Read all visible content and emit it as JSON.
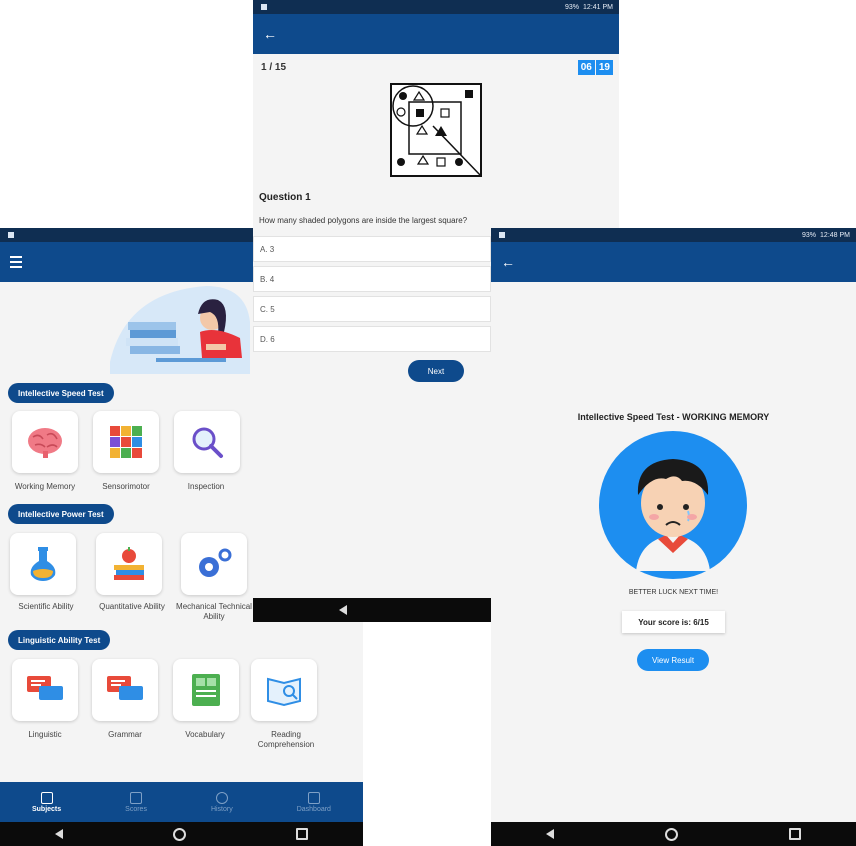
{
  "status_mid": {
    "battery": "93%",
    "time": "12:41 PM"
  },
  "status_right": {
    "battery": "93%",
    "time": "12:48 PM"
  },
  "home": {
    "sections": [
      {
        "title": "Intellective Speed Test",
        "items": [
          "Working Memory",
          "Sensorimotor",
          "Inspection"
        ]
      },
      {
        "title": "Intellective Power Test",
        "items": [
          "Scientific Ability",
          "Quantitative Ability",
          "Mechanical Technical Ability"
        ]
      },
      {
        "title": "Linguistic Ability Test",
        "items": [
          "Linguistic",
          "Grammar",
          "Vocabulary",
          "Reading Comprehension"
        ]
      }
    ],
    "bottom_nav": [
      "Subjects",
      "Scores",
      "History",
      "Dashboard"
    ]
  },
  "quiz": {
    "counter": "1 / 15",
    "timer_min": "06",
    "timer_sec": "19",
    "question_title": "Question 1",
    "question_text": "How many shaded polygons are inside the largest square?",
    "options": [
      "A. 3",
      "B. 4",
      "C. 5",
      "D. 6"
    ],
    "next_label": "Next"
  },
  "result": {
    "title": "Intellective Speed Test - WORKING MEMORY",
    "message": "BETTER LUCK NEXT TIME!",
    "score": "Your score is: 6/15",
    "view_label": "View Result"
  },
  "colors": {
    "primary": "#0e4a8c",
    "accent": "#1d8ef0",
    "status": "#0f2e52"
  }
}
